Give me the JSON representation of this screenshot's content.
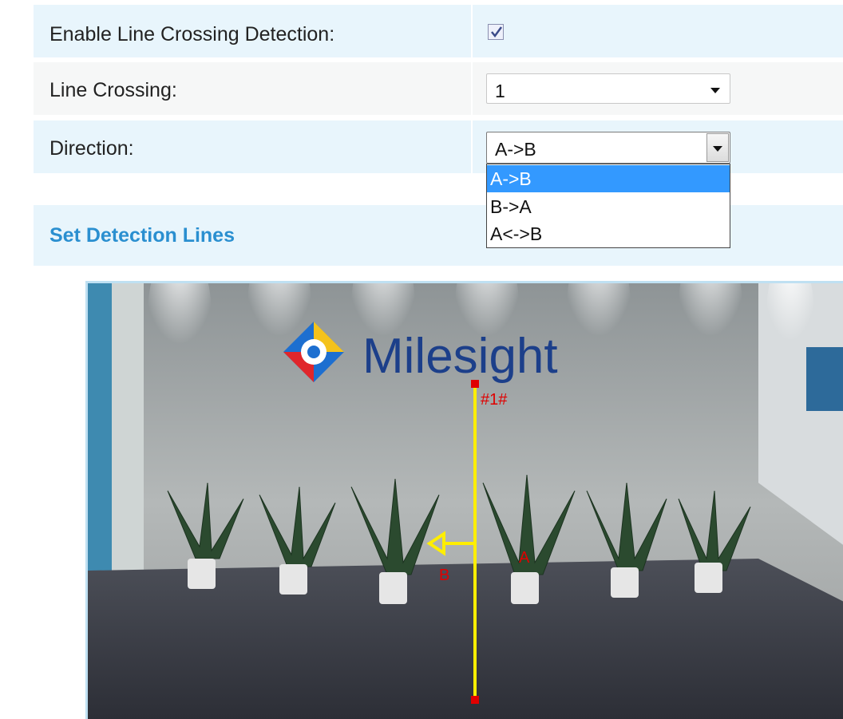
{
  "form": {
    "enable_label": "Enable Line Crossing Detection:",
    "enable_checked": true,
    "line_crossing_label": "Line Crossing:",
    "line_crossing_value": "1",
    "direction_label": "Direction:",
    "direction_value": "A->B",
    "direction_options": [
      "A->B",
      "B->A",
      "A<->B"
    ],
    "direction_selected_index": 0
  },
  "section": {
    "title": "Set Detection Lines"
  },
  "video": {
    "brand_text": "Milesight",
    "line_id": "#1#",
    "side_a": "A",
    "side_b": "B",
    "line_color": "#ffee00",
    "marker_color": "#e00000"
  },
  "colors": {
    "row_blue": "#e8f5fc",
    "row_grey": "#f6f7f7",
    "accent": "#2a8fd0",
    "highlight": "#3399ff"
  }
}
